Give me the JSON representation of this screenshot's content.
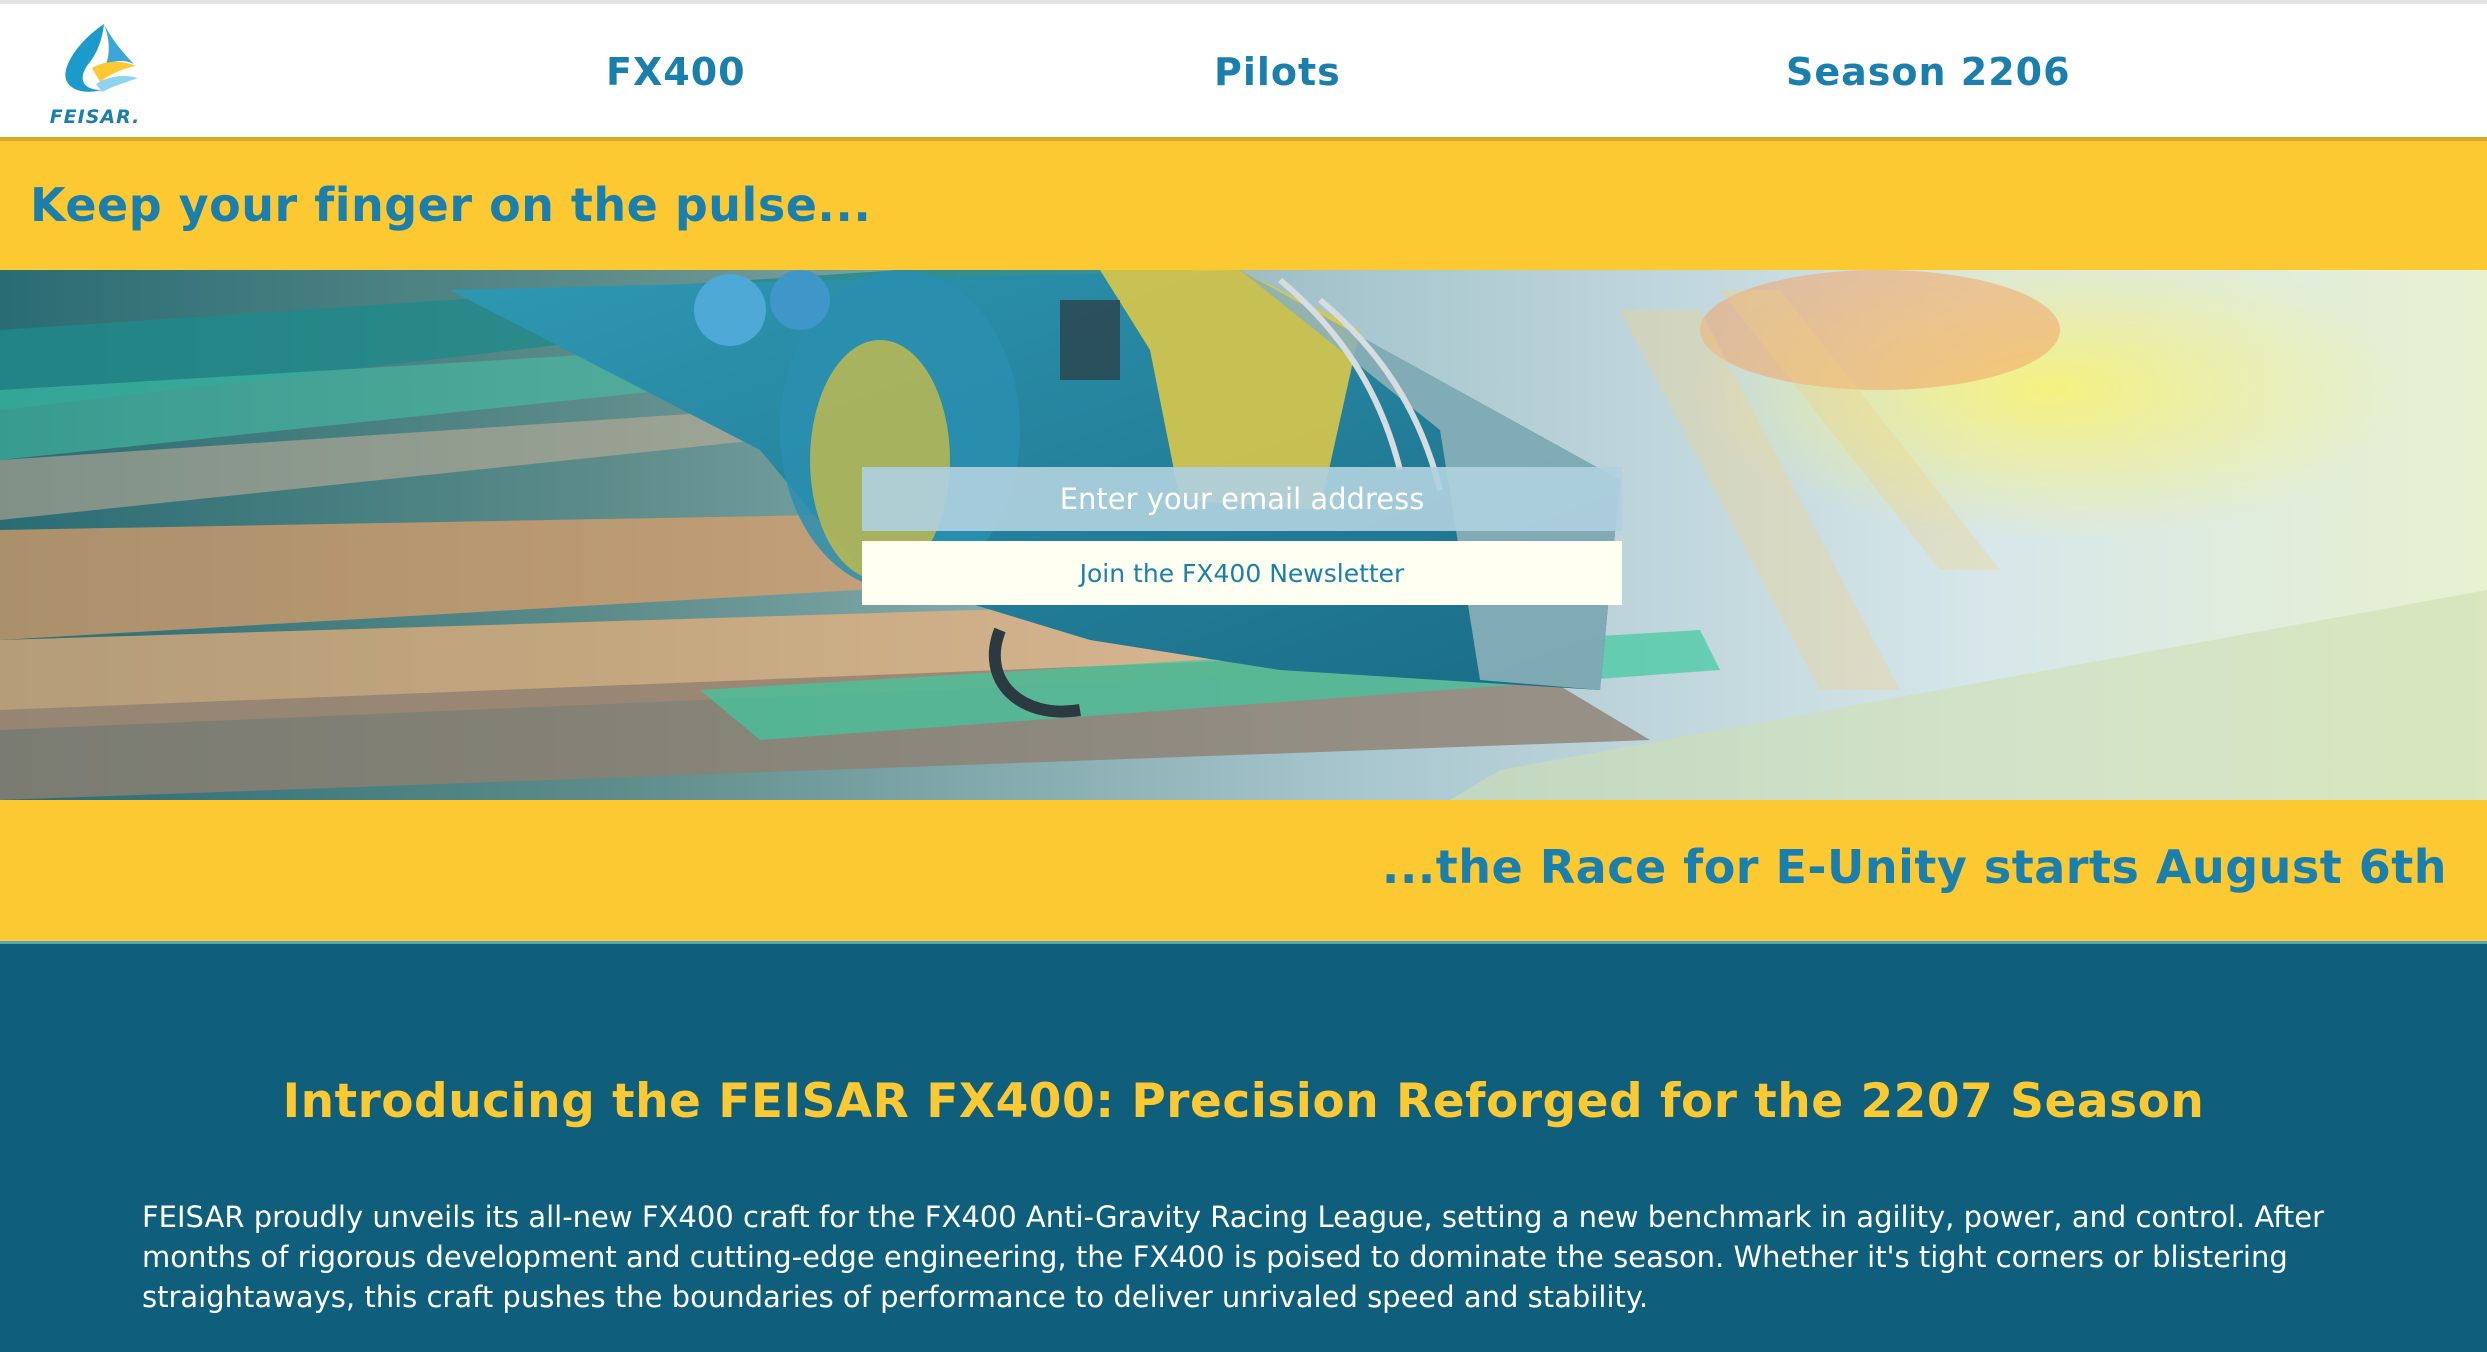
{
  "header": {
    "logo_text": "FEISAR.",
    "nav": [
      {
        "label": "FX400"
      },
      {
        "label": "Pilots"
      },
      {
        "label": "Season 2206"
      }
    ]
  },
  "hero": {
    "tagline_top": "Keep your finger on the pulse...",
    "tagline_bottom": "...the Race for E-Unity starts August 6th",
    "email_placeholder": "Enter your email address",
    "email_value": "",
    "join_button_label": "Join the FX400 Newsletter"
  },
  "intro": {
    "title": "Introducing the FEISAR FX400: Precision Reforged for the 2207 Season",
    "body": "FEISAR proudly unveils its all-new FX400 craft for the FX400 Anti-Gravity Racing League, setting a new benchmark in agility, power, and control. After months of rigorous development and cutting-edge engineering, the FX400 is poised to dominate the season. Whether it's tight corners or blistering straightaways, this craft pushes the boundaries of performance to deliver unrivaled speed and stability."
  },
  "colors": {
    "brand_blue": "#1b7fae",
    "accent_yellow": "#fcc932",
    "section_teal": "#0e5e7c"
  }
}
